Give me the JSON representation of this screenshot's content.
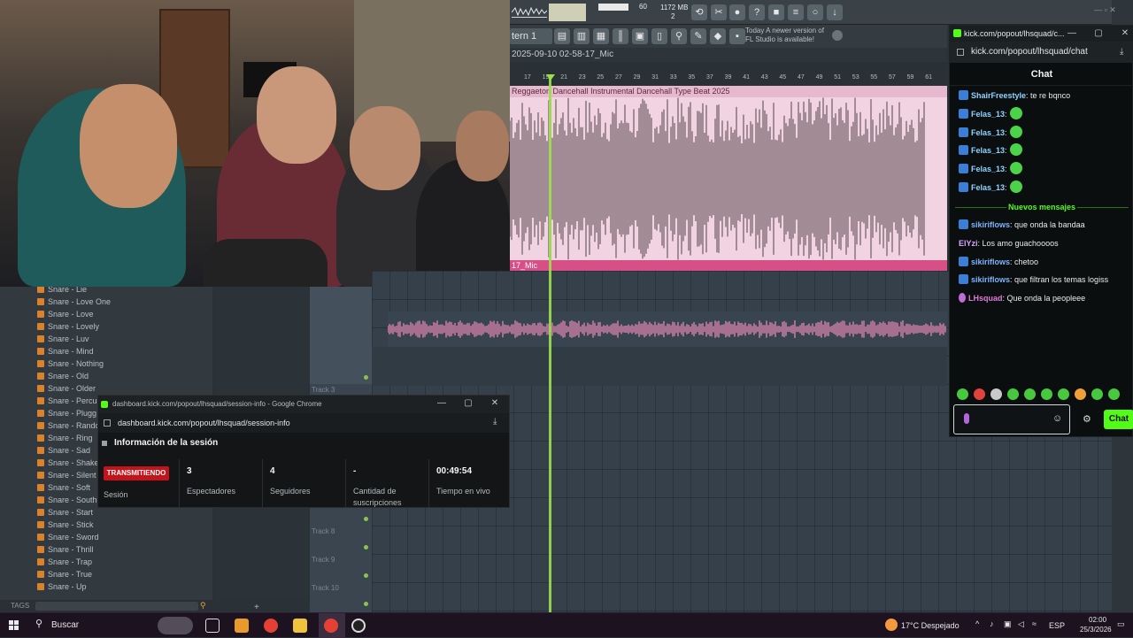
{
  "fl": {
    "cpu_label": "1172 MB",
    "cpu_small": "60",
    "cpu_small2": "2",
    "pattern": "tern 1",
    "news_line1": "Today  A newer version of",
    "news_line2": "FL Studio is available!",
    "clip_title": "2025-09-10 02-58-17_Mic",
    "ruler": [
      "17",
      "19",
      "21",
      "23",
      "25",
      "27",
      "29",
      "31",
      "33",
      "35",
      "37",
      "39",
      "41",
      "43",
      "45",
      "47",
      "49",
      "51",
      "53",
      "55",
      "57",
      "59",
      "61"
    ],
    "clip1_name": "Reggaeton Dancehall  Instrumental Dancehall Type Beat 2025",
    "clip1_bar": "17_Mic",
    "tracks": [
      "Track 3",
      "Track 8",
      "Track 9",
      "Track 10"
    ]
  },
  "browser": {
    "items": [
      "Snare - Lie",
      "Snare - Love One",
      "Snare - Love",
      "Snare - Lovely",
      "Snare - Luv",
      "Snare - Mind",
      "Snare - Nothing",
      "Snare - Old",
      "Snare - Older",
      "Snare - Percus",
      "Snare - Plugg",
      "Snare - Rando",
      "Snare - Ring",
      "Snare - Sad",
      "Snare - Shaker",
      "Snare - Silent",
      "Snare - Soft",
      "Snare - South",
      "Snare - Start",
      "Snare - Stick",
      "Snare - Sword",
      "Snare - Thrill",
      "Snare - Trap",
      "Snare - True",
      "Snare - Up"
    ],
    "tags_label": "TAGS",
    "folder_color": "#d9822b"
  },
  "chat": {
    "window_title": "kick.com/popout/lhsquad/c...",
    "url": "kick.com/popout/lhsquad/chat",
    "heading": "Chat",
    "messages_old": [
      {
        "user": "ShairFreestyle",
        "text": ": te re bqnco",
        "emote": false
      },
      {
        "user": "Felas_13",
        "text": ":",
        "emote": true
      },
      {
        "user": "Felas_13",
        "text": ":",
        "emote": true
      },
      {
        "user": "Felas_13",
        "text": ":",
        "emote": true
      },
      {
        "user": "Felas_13",
        "text": ":",
        "emote": true
      },
      {
        "user": "Felas_13",
        "text": ":",
        "emote": true
      }
    ],
    "new_messages_label": "Nuevos mensajes",
    "messages_new": [
      {
        "user": "sikiriflows",
        "text": ": que onda la bandaa",
        "color": "#7fb3ff",
        "badge": true
      },
      {
        "user": "ElYzi",
        "text": ": Los amo guachoooos",
        "color": "#d7a7ff",
        "badge": false
      },
      {
        "user": "sikiriflows",
        "text": ": chetoo",
        "color": "#7fb3ff",
        "badge": true
      },
      {
        "user": "sikiriflows",
        "text": ": que filtran los temas logiss",
        "color": "#7fb3ff",
        "badge": true
      },
      {
        "user": "LHsquad",
        "text": ": Que onda la peopleee",
        "color": "#e07ad8",
        "badge": "mic"
      }
    ],
    "send_label": "Chat",
    "accent": "#53fc18"
  },
  "session": {
    "window_title": "dashboard.kick.com/popout/lhsquad/session-info - Google Chrome",
    "url": "dashboard.kick.com/popout/lhsquad/session-info",
    "heading": "Información de la sesión",
    "live_badge": "TRANSMITIENDO",
    "session_label": "Sesión",
    "viewers_value": "3",
    "viewers_label": "Espectadores",
    "followers_value": "4",
    "followers_label": "Seguidores",
    "subs_value": "-",
    "subs_label_1": "Cantidad de",
    "subs_label_2": "suscripciones",
    "uptime_value": "00:49:54",
    "uptime_label": "Tiempo en vivo"
  },
  "taskbar": {
    "search_placeholder": "Buscar",
    "weather": "17°C  Despejado",
    "lang": "ESP",
    "time": "02:00",
    "date": "25/3/2026"
  }
}
